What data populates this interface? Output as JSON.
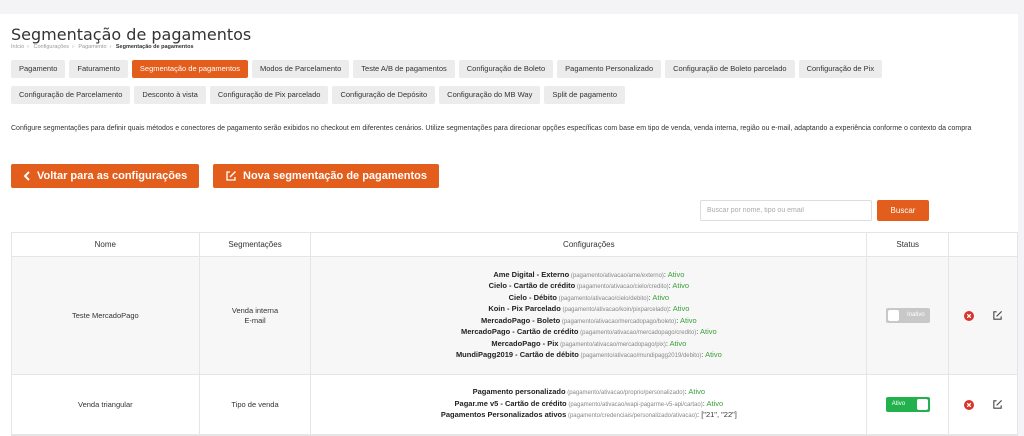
{
  "page": {
    "title": "Segmentação de pagamentos",
    "breadcrumb": [
      "Início",
      "Configurações",
      "Pagamento",
      "Segmentação de pagamentos"
    ]
  },
  "tabs_row1": [
    "Pagamento",
    "Faturamento",
    "Segmentação de pagamentos",
    "Modos de Parcelamento",
    "Teste A/B de pagamentos",
    "Configuração de Boleto",
    "Pagamento Personalizado",
    "Configuração de Boleto parcelado",
    "Configuração de Pix"
  ],
  "tabs_row2": [
    "Configuração de Parcelamento",
    "Desconto à vista",
    "Configuração de Pix parcelado",
    "Configuração de Depósito",
    "Configuração do MB Way",
    "Split de pagamento"
  ],
  "active_tab": "Segmentação de pagamentos",
  "description": "Configure segmentações para definir quais métodos e conectores de pagamento serão exibidos no checkout em diferentes cenários. Utilize segmentações para direcionar opções específicas com base em tipo de venda, venda interna, região ou e-mail, adaptando a experiência conforme o contexto da compra",
  "actions": {
    "back_label": "Voltar para as configurações",
    "new_label": "Nova segmentação de pagamentos"
  },
  "search": {
    "placeholder": "Buscar por nome, tipo ou email",
    "button": "Buscar"
  },
  "table": {
    "headers": {
      "nome": "Nome",
      "segmentacoes": "Segmentações",
      "configuracoes": "Configurações",
      "status": "Status"
    },
    "rows": [
      {
        "nome": "Teste MercadoPago",
        "segmentacoes": [
          "Venda interna",
          "E-mail"
        ],
        "configuracoes": [
          {
            "name": "Ame Digital - Externo",
            "path": " (pagamento/ativacao/ame/externo)",
            "sep": ": ",
            "status": "Ativo"
          },
          {
            "name": "Cielo - Cartão de crédito",
            "path": " (pagamento/ativacao/cielo/credito)",
            "sep": ": ",
            "status": "Ativo"
          },
          {
            "name": "Cielo - Débito",
            "path": " (pagamento/ativacao/cielo/debito)",
            "sep": ": ",
            "status": "Ativo"
          },
          {
            "name": "Koin - Pix Parcelado",
            "path": " (pagamento/ativacao/koin/pixparcelado)",
            "sep": ": ",
            "status": "Ativo"
          },
          {
            "name": "MercadoPago - Boleto",
            "path": " (pagamento/ativacao/mercadopago/boleto)",
            "sep": ": ",
            "status": "Ativo"
          },
          {
            "name": "MercadoPago - Cartão de crédito",
            "path": " (pagamento/ativacao/mercadopago/credito)",
            "sep": ": ",
            "status": "Ativo"
          },
          {
            "name": "MercadoPago - Pix",
            "path": " (pagamento/ativacao/mercadopago/pix)",
            "sep": ": ",
            "status": "Ativo"
          },
          {
            "name": "MundiPagg2019 - Cartão de débito",
            "path": " (pagamento/ativacao/mundipagg2019/debito)",
            "sep": ": ",
            "status": "Ativo"
          }
        ],
        "status": "Inativo",
        "active": false
      },
      {
        "nome": "Venda triangular",
        "segmentacoes": [
          "Tipo de venda"
        ],
        "configuracoes": [
          {
            "name": "Pagamento personalizado",
            "path": " (pagamento/ativacao/proprio/personalizado)",
            "sep": ": ",
            "status": "Ativo"
          },
          {
            "name": "Pagar.me v5 - Cartão de crédito",
            "path": " (pagamento/ativacao/wapi-pagarme-v5-api/cartao)",
            "sep": ": ",
            "status": "Ativo"
          },
          {
            "name": "Pagamentos Personalizados ativos",
            "path": " (pagamento/credenciais/personalizado/ativacao)",
            "sep": ": ",
            "value": "[\"21\", \"22\"]"
          }
        ],
        "status": "Ativo",
        "active": true
      }
    ]
  },
  "colors": {
    "accent": "#e35d1c",
    "active_green": "#22b14c",
    "status_text": "#3aa03a",
    "delete_red": "#d9342b"
  }
}
